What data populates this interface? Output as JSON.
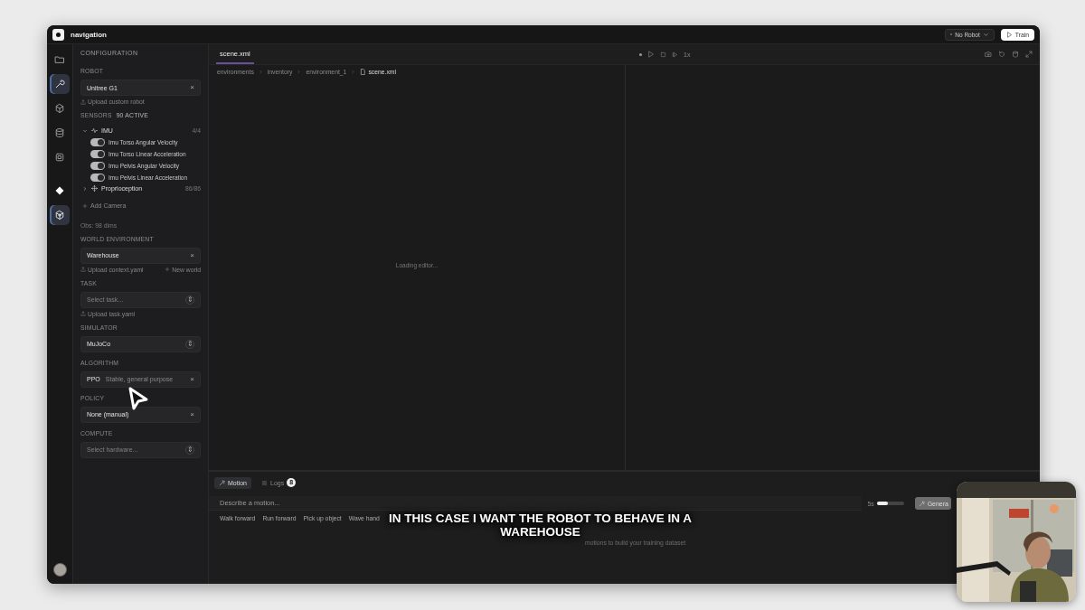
{
  "window": {
    "title": "navigation"
  },
  "header": {
    "robot_select": "No Robot",
    "train_button": "Train"
  },
  "rail": [
    {
      "kind": "folder",
      "selected": false
    },
    {
      "kind": "wrench",
      "selected": true
    },
    {
      "kind": "cube",
      "selected": false
    },
    {
      "kind": "database",
      "selected": false
    },
    {
      "kind": "chip",
      "selected": false
    },
    {
      "kind": "diamond",
      "selected": false
    },
    {
      "kind": "box",
      "selected": true
    }
  ],
  "sidebar": {
    "title": "CONFIGURATION",
    "sections": [
      {
        "kind": "field",
        "label": "ROBOT",
        "value": "Unitree G1",
        "control": {
          "kind": "clear",
          "symbol": "×"
        },
        "link": "Upload custom robot"
      },
      {
        "kind": "sensors",
        "label": "SENSORS",
        "badge": "90 ACTIVE",
        "groups": [
          {
            "name": "IMU",
            "count": "4/4",
            "expanded": true,
            "children": [
              {
                "name": "Imu Torso Angular Velocity",
                "on": true
              },
              {
                "name": "Imu Torso Linear Acceleration",
                "on": true
              },
              {
                "name": "Imu Pelvis Angular Velocity",
                "on": true
              },
              {
                "name": "Imu Pelvis Linear Acceleration",
                "on": true
              }
            ]
          },
          {
            "name": "Proprioception",
            "count": "86/86",
            "expanded": false
          }
        ],
        "add": "Add Camera",
        "obs": "Obs: 98 dims"
      },
      {
        "kind": "field",
        "label": "WORLD ENVIRONMENT",
        "value": "Warehouse",
        "control": {
          "kind": "clear",
          "symbol": "×"
        },
        "link": "Upload context.yaml",
        "link2": "New world"
      },
      {
        "kind": "field",
        "label": "TASK",
        "placeholder": "Select task...",
        "control": {
          "kind": "select",
          "symbol": "⇕"
        },
        "link": "Upload task.yaml"
      },
      {
        "kind": "field",
        "label": "SIMULATOR",
        "value": "MuJoCo",
        "control": {
          "kind": "select",
          "symbol": "⇕"
        }
      },
      {
        "kind": "field",
        "label": "ALGORITHM",
        "value": "PPO",
        "note": "Stable, general purpose",
        "control": {
          "kind": "clear",
          "symbol": "×"
        }
      },
      {
        "kind": "field",
        "label": "POLICY",
        "value": "None (manual)",
        "control": {
          "kind": "clear",
          "symbol": "×"
        }
      },
      {
        "kind": "field",
        "label": "COMPUTE",
        "placeholder": "Select hardware...",
        "control": {
          "kind": "select",
          "symbol": "⇕"
        }
      }
    ]
  },
  "editor": {
    "tabs": [
      {
        "label": "scene.xml",
        "selected": true
      }
    ],
    "breadcrumb": [
      "environments",
      "inventory",
      "environment_1",
      "scene.xml"
    ],
    "status": "Loading editor..."
  },
  "viewer": {
    "speed": "1x"
  },
  "bottom": {
    "tabs": [
      {
        "label": "Motion",
        "selected": true
      },
      {
        "label": "Logs",
        "selected": false,
        "badge": "8"
      }
    ],
    "input": {
      "placeholder": "Describe a motion..."
    },
    "duration": {
      "label": "5s",
      "level": 0.4
    },
    "generate_button": "Genera",
    "suggestions": [
      "Walk forward",
      "Run forward",
      "Pick up object",
      "Wave hand"
    ],
    "hint": "motions to build your training dataset"
  },
  "caption": "IN THIS CASE I WANT THE ROBOT TO BEHAVE IN A WAREHOUSE"
}
